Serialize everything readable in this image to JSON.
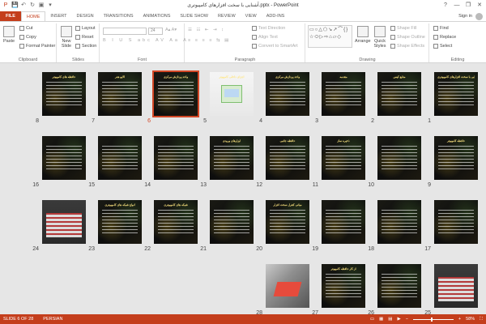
{
  "window": {
    "title": "آشنایی با سخت افزارهای کامپیوتری.pptx - PowerPoint",
    "help": "?",
    "minimize": "—",
    "restore": "❐",
    "close": "✕"
  },
  "qat": {
    "save": "💾",
    "undo": "↶",
    "redo": "↻",
    "start": "▣",
    "customize": "▾"
  },
  "tabs": [
    "FILE",
    "HOME",
    "INSERT",
    "DESIGN",
    "TRANSITIONS",
    "ANIMATIONS",
    "SLIDE SHOW",
    "REVIEW",
    "VIEW",
    "ADD-INS"
  ],
  "active_tab": "HOME",
  "sign_in": "Sign in",
  "ribbon": {
    "clipboard": {
      "label": "Clipboard",
      "paste": "Paste",
      "cut": "Cut",
      "copy": "Copy",
      "format_painter": "Format Painter"
    },
    "slides": {
      "label": "Slides",
      "new_slide": "New Slide",
      "layout": "Layout",
      "reset": "Reset",
      "section": "Section"
    },
    "font": {
      "label": "Font",
      "size": "24"
    },
    "paragraph": {
      "label": "Paragraph",
      "text_direction": "Text Direction",
      "align_text": "Align Text",
      "smartart": "Convert to SmartArt"
    },
    "drawing": {
      "label": "Drawing",
      "arrange": "Arrange",
      "quick_styles": "Quick Styles",
      "shape_fill": "Shape Fill",
      "shape_outline": "Shape Outline",
      "shape_effects": "Shape Effects",
      "shapes_glyphs": "▭○△⬠↘↗⌒{}☆⬭▷⇨⌂▱◇"
    },
    "editing": {
      "label": "Editing",
      "find": "Find",
      "replace": "Replace",
      "select": "Select"
    }
  },
  "slides": [
    {
      "n": "1",
      "title": "آشنایی با سخت افزارهای کامپیوتری",
      "style": "dark"
    },
    {
      "n": "2",
      "title": "منابع کیس",
      "style": "dark"
    },
    {
      "n": "3",
      "title": "مقدمه",
      "style": "dark"
    },
    {
      "n": "4",
      "title": "واحد پردازش مرکزی",
      "style": "dark"
    },
    {
      "n": "5",
      "title": "اجزای داخلی کامپیوتر",
      "style": "light"
    },
    {
      "n": "6",
      "title": "واحد پردازش مرکزی",
      "style": "dark",
      "selected": true
    },
    {
      "n": "7",
      "title": "الایو هدر",
      "style": "dark"
    },
    {
      "n": "8",
      "title": "حافظه های کامپیوتر",
      "style": "dark"
    },
    {
      "n": "9",
      "title": "حافظه کامپیوتر",
      "style": "dark"
    },
    {
      "n": "10",
      "title": "",
      "style": "dark"
    },
    {
      "n": "11",
      "title": "ذخیره ساز",
      "style": "dark"
    },
    {
      "n": "12",
      "title": "حافظه جانبی",
      "style": "dark"
    },
    {
      "n": "13",
      "title": "ابزارهای ورودی",
      "style": "dark"
    },
    {
      "n": "14",
      "title": "",
      "style": "dark"
    },
    {
      "n": "15",
      "title": "",
      "style": "dark"
    },
    {
      "n": "16",
      "title": "",
      "style": "dark"
    },
    {
      "n": "17",
      "title": "",
      "style": "dark"
    },
    {
      "n": "18",
      "title": "",
      "style": "dark"
    },
    {
      "n": "19",
      "title": "",
      "style": "dark"
    },
    {
      "n": "20",
      "title": "مبانی کنترل سخت افزار",
      "style": "dark"
    },
    {
      "n": "21",
      "title": "",
      "style": "dark"
    },
    {
      "n": "22",
      "title": "شبکه های کامپیوتری",
      "style": "dark"
    },
    {
      "n": "23",
      "title": "انواع شبکه های کامپیوتری",
      "style": "dark"
    },
    {
      "n": "24",
      "title": "",
      "style": "red"
    },
    {
      "n": "25",
      "title": "",
      "style": "red"
    },
    {
      "n": "26",
      "title": "",
      "style": "dark"
    },
    {
      "n": "27",
      "title": "از کار حافظه کامپیوتر",
      "style": "dark"
    },
    {
      "n": "28",
      "title": "",
      "style": "photo"
    }
  ],
  "status": {
    "slide_of": "SLIDE 6 OF 28",
    "language": "PERSIAN",
    "zoom": "58%",
    "zoom_fraction": 0.58
  }
}
